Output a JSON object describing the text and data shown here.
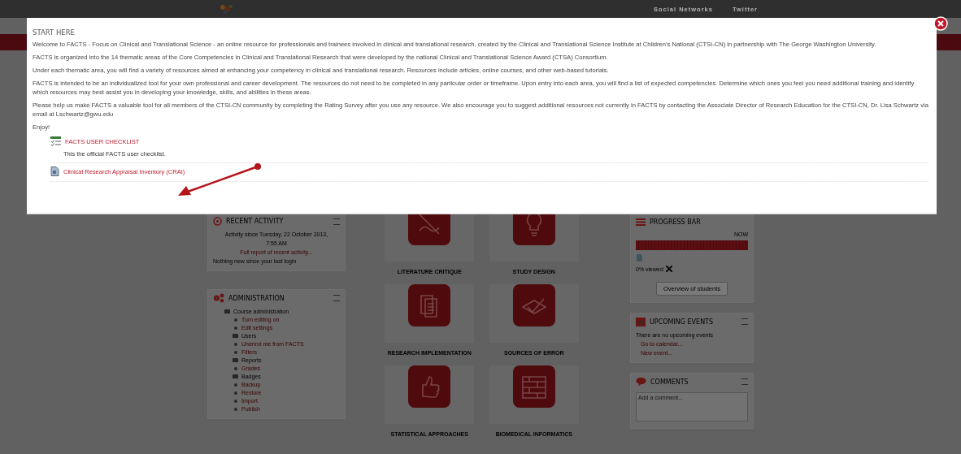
{
  "top_bar": {
    "nav": [
      "Social Networks",
      "Twitter"
    ]
  },
  "modal": {
    "title": "START HERE",
    "paragraphs": [
      "Welcome to FACTS - Focus on Clinical and Translational Science - an online resource for professionals and trainees involved in clinical and translational research, created by the Clinical and Translational Science Institute at Children's National (CTSI-CN) in partnership with The George Washington University.",
      "FACTS is organized into the 14 thematic areas of the Core Competencies in Clinical and Translational Research that were developed by the national Clinical and Translational Science Award (CTSA) Consortium.",
      "Under each thematic area, you will find a variety of resources aimed at enhancing your competency in clinical and translational research. Resources include articles, online courses, and other web-based tutorials.",
      "FACTS is intended to be an individualized tool for your own professional and career development. The resources do not need to be completed in any particular order or timeframe. Upon entry into each area, you will find a list of expected competencies. Determine which ones you feel you need additional training and identify which resources may best assist you in developing your knowledge, skills, and abilities in these areas.",
      "Please help us make FACTS a valuable tool for all members of the CTSI-CN community by completing the Rating Survey after you use any resource. We also encourage you to suggest additional resources not currently in FACTS by contacting the Associate Director of Research Education for the CTSI-CN, Dr. Lisa Schwartz via email at Lschwartz@gwu.edu",
      "Enjoy!"
    ],
    "resources": [
      {
        "kind": "checklist",
        "title": "FACTS USER CHECKLIST",
        "description": "This the official FACTS user checklist."
      },
      {
        "kind": "document",
        "title": "Clinical Research Appraisal Inventory (CRAI)"
      }
    ]
  },
  "recent_activity": {
    "title": "RECENT ACTIVITY",
    "since": "Activity since Tuesday, 22 October 2013,",
    "time": "7:55 AM",
    "report_link": "Full report of recent activity...",
    "note": "Nothing new since your last login"
  },
  "administration": {
    "title": "ADMINISTRATION",
    "items": [
      {
        "label": "Course administration",
        "kind": "folder",
        "children": [
          {
            "label": "Turn editing on",
            "kind": "link"
          },
          {
            "label": "Edit settings",
            "kind": "link"
          },
          {
            "label": "Users",
            "kind": "folder"
          },
          {
            "label": "Unenrol me from FACTS",
            "kind": "link"
          },
          {
            "label": "Filters",
            "kind": "link"
          },
          {
            "label": "Reports",
            "kind": "folder"
          },
          {
            "label": "Grades",
            "kind": "link"
          },
          {
            "label": "Badges",
            "kind": "folder"
          },
          {
            "label": "Backup",
            "kind": "link"
          },
          {
            "label": "Restore",
            "kind": "link"
          },
          {
            "label": "Import",
            "kind": "link"
          },
          {
            "label": "Publish",
            "kind": "link"
          }
        ]
      }
    ]
  },
  "tiles": [
    {
      "label": "LITERATURE CRITIQUE"
    },
    {
      "label": "STUDY DESIGN"
    },
    {
      "label": "RESEARCH IMPLEMENTATION"
    },
    {
      "label": "SOURCES OF ERROR"
    },
    {
      "label": "STATISTICAL APPROACHES"
    },
    {
      "label": "BIOMEDICAL INFORMATICS"
    }
  ],
  "progress_bar": {
    "title": "PROGRESS BAR",
    "now_label": "NOW",
    "viewed": "0% viewed",
    "button": "Overview of students"
  },
  "upcoming_events": {
    "title": "UPCOMING EVENTS",
    "text": "There are no upcoming events",
    "links": [
      "Go to calendar...",
      "New event..."
    ]
  },
  "comments": {
    "title": "COMMENTS",
    "placeholder": "Add a comment..."
  }
}
